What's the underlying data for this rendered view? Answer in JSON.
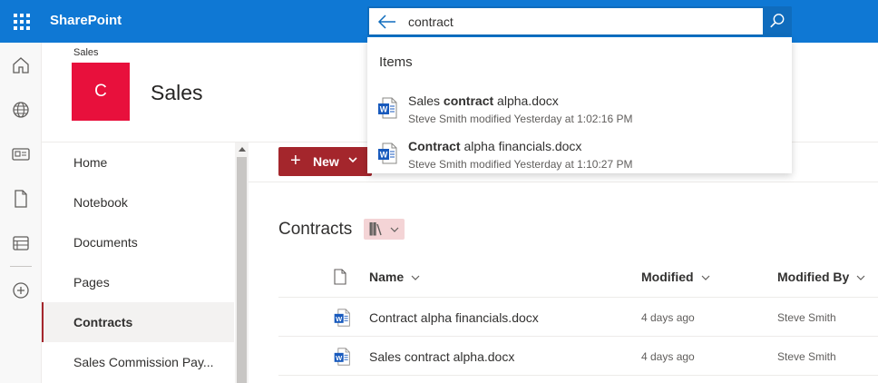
{
  "app": {
    "title": "SharePoint"
  },
  "search": {
    "query": "contract",
    "suggestions_heading": "Items",
    "suggestions": [
      {
        "prefix": "Sales ",
        "match": "contract",
        "suffix": " alpha.docx",
        "meta": "Steve Smith modified Yesterday at 1:02:16 PM",
        "icon": "word-doc-icon"
      },
      {
        "prefix": "",
        "match": "Contract",
        "suffix": " alpha financials.docx",
        "meta": "Steve Smith modified Yesterday at 1:10:27 PM",
        "icon": "word-doc-icon"
      }
    ]
  },
  "site": {
    "breadcrumb": "Sales",
    "logo_letter": "C",
    "logo_color": "#e8103c",
    "title": "Sales"
  },
  "nav": {
    "items": [
      {
        "label": "Home",
        "active": false
      },
      {
        "label": "Notebook",
        "active": false
      },
      {
        "label": "Documents",
        "active": false
      },
      {
        "label": "Pages",
        "active": false
      },
      {
        "label": "Contracts",
        "active": true
      },
      {
        "label": "Sales Commission Pay...",
        "active": false
      }
    ]
  },
  "rail": {
    "icons": [
      "home-icon",
      "globe-icon",
      "news-icon",
      "document-icon",
      "lists-icon",
      "add-icon"
    ]
  },
  "command_bar": {
    "new_label": "New"
  },
  "library": {
    "title": "Contracts",
    "columns": {
      "name": "Name",
      "modified": "Modified",
      "modified_by": "Modified By"
    },
    "rows": [
      {
        "name": "Contract alpha financials.docx",
        "modified": "4 days ago",
        "modified_by": "Steve Smith"
      },
      {
        "name": "Sales contract alpha.docx",
        "modified": "4 days ago",
        "modified_by": "Steve Smith"
      }
    ]
  },
  "colors": {
    "suite_bar": "#0f78d4",
    "accent": "#a4262c",
    "word_blue": "#185abd"
  }
}
